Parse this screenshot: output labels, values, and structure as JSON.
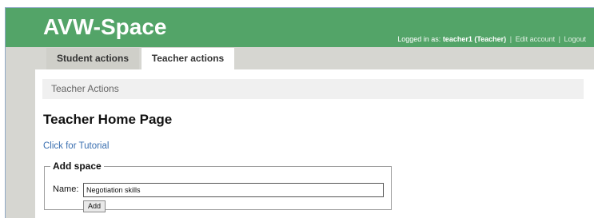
{
  "app": {
    "title": "AVW-Space"
  },
  "account": {
    "prefix": "Logged in as:",
    "user": "teacher1 (Teacher)",
    "separator": "|",
    "edit_label": "Edit account",
    "logout_label": "Logout"
  },
  "tabs": [
    {
      "label": "Student actions",
      "active": false
    },
    {
      "label": "Teacher actions",
      "active": true
    }
  ],
  "breadcrumb": {
    "label": "Teacher Actions"
  },
  "main": {
    "heading": "Teacher Home Page",
    "tutorial_link": "Click for Tutorial"
  },
  "add_space": {
    "legend": "Add space",
    "name_label": "Name:",
    "name_value": "Negotiation skills",
    "add_button": "Add"
  },
  "colors": {
    "header": "#53a468",
    "page_bg": "#d6d6d1",
    "link": "#3a6fb0"
  }
}
